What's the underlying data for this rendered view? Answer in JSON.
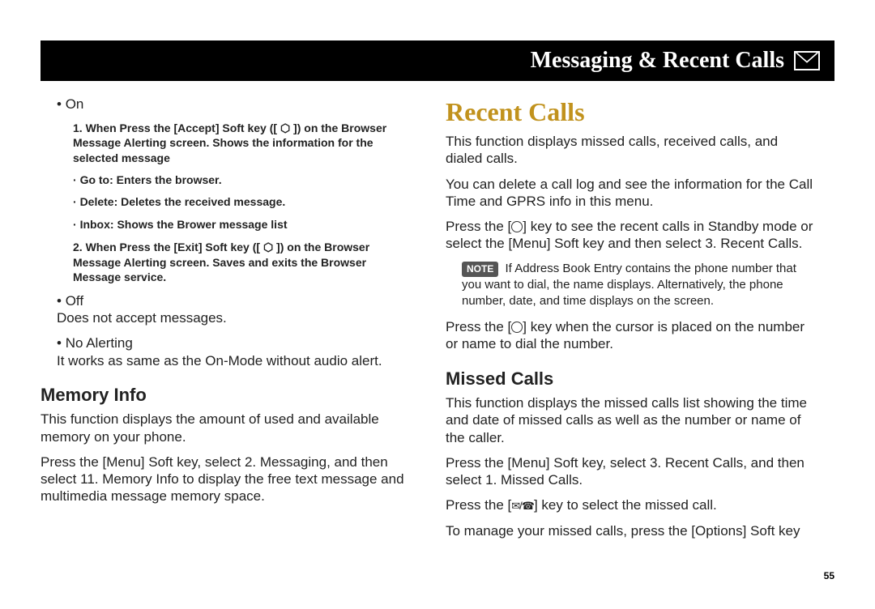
{
  "header": {
    "title": "Messaging & Recent Calls"
  },
  "left": {
    "on_label": "On",
    "item1": "1. When Press the [Accept] Soft key ([ ⬡ ]) on the Browser Message Alerting screen. Shows the information for the selected message",
    "goto": "Go to: Enters the browser.",
    "delete": "Delete: Deletes the received message.",
    "inbox": "Inbox: Shows the Brower message list",
    "item2": "2. When Press the [Exit] Soft key ([ ⬡ ]) on the Browser Message Alerting screen. Saves and exits the Browser Message service.",
    "off_label": "Off",
    "off_desc": "Does not accept messages.",
    "noalert_label": "No Alerting",
    "noalert_desc": "It works as same as the On-Mode without audio alert.",
    "mem_h2": "Memory Info",
    "mem_p1": "This function displays the amount of used and available memory on your phone.",
    "mem_p2": "Press the [Menu] Soft key, select 2. Messaging, and then select 11. Memory Info to display the free text message and multimedia message memory space."
  },
  "right": {
    "recent_h1": "Recent Calls",
    "recent_p1": "This function displays missed calls, received calls, and dialed calls.",
    "recent_p2": "You can delete a call log and see the information for the Call Time and GPRS info in this menu.",
    "recent_p3_a": "Press the [",
    "recent_p3_b": "] key to see the recent calls in Standby mode or select the [Menu] Soft key and then select 3. Recent Calls.",
    "note_badge": "NOTE",
    "note_text": "If Address Book Entry contains the phone number that you want to dial, the name displays. Alternatively, the phone number, date, and time displays on the screen.",
    "recent_p4_a": "Press the [",
    "recent_p4_b": "] key when the cursor is placed on the number or name to dial the number.",
    "missed_h2": "Missed Calls",
    "missed_p1": "This function displays the missed calls list showing the time and date of missed calls as well as the number or name of the caller.",
    "missed_p2": "Press the [Menu] Soft key, select 3. Recent Calls, and then select 1. Missed Calls.",
    "missed_p3_a": "Press the [",
    "missed_p3_b": "] key to select the missed call.",
    "missed_p4": "To manage your missed calls, press the [Options] Soft key"
  },
  "page_number": "55"
}
